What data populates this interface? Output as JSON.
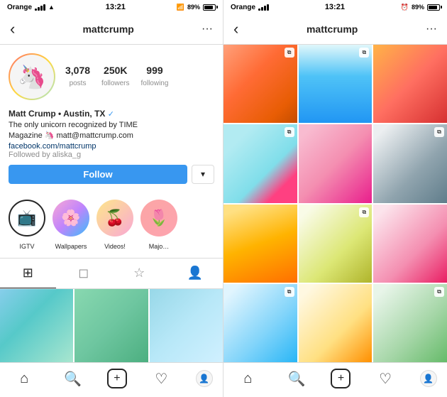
{
  "left": {
    "status": {
      "carrier": "Orange",
      "time": "13:21",
      "battery": "89%"
    },
    "nav": {
      "back_icon": "‹",
      "title": "mattcrump",
      "more_icon": "···"
    },
    "profile": {
      "avatar_emoji": "🦄",
      "stats": [
        {
          "number": "3,078",
          "label": "posts"
        },
        {
          "number": "250K",
          "label": "followers"
        },
        {
          "number": "999",
          "label": "following"
        }
      ],
      "name": "Matt Crump • Austin, TX",
      "verified": "✓",
      "bio_lines": [
        "The only unicorn recognized by TIME",
        "Magazine 🦄 matt@mattcrump.com",
        "facebook.com/mattcrump"
      ],
      "followed_by": "Followed by aliska_g",
      "follow_label": "Follow",
      "dropdown_label": "▾"
    },
    "stories": [
      {
        "label": "IGTV",
        "icon": "📺"
      },
      {
        "label": "Wallpapers",
        "icon": "🌸"
      },
      {
        "label": "Videos!",
        "icon": "🍒"
      },
      {
        "label": "Majo…",
        "icon": "🌷"
      }
    ],
    "tabs": [
      {
        "icon": "⊞",
        "active": true
      },
      {
        "icon": "◻",
        "active": false
      },
      {
        "icon": "☆",
        "active": false
      },
      {
        "icon": "👤",
        "active": false
      }
    ],
    "grid_colors": [
      "lc1",
      "c2",
      "c3",
      "c4",
      "c5",
      "c6"
    ],
    "bottom_nav": [
      {
        "icon": "⌂",
        "label": "home"
      },
      {
        "icon": "🔍",
        "label": "search"
      },
      {
        "icon": "⊕",
        "label": "add"
      },
      {
        "icon": "♡",
        "label": "activity"
      },
      {
        "icon": "👤",
        "label": "profile"
      }
    ]
  },
  "right": {
    "status": {
      "carrier": "Orange",
      "time": "13:21",
      "battery": "89%"
    },
    "nav": {
      "back_icon": "‹",
      "title": "mattcrump",
      "more_icon": "···"
    },
    "grid_colors": [
      "c1",
      "c2",
      "c3",
      "c4",
      "c5",
      "c6",
      "c7",
      "c8",
      "c9",
      "c10",
      "c11",
      "c12"
    ],
    "bottom_nav": [
      {
        "icon": "⌂",
        "label": "home"
      },
      {
        "icon": "🔍",
        "label": "search"
      },
      {
        "icon": "⊕",
        "label": "add"
      },
      {
        "icon": "♡",
        "label": "activity"
      },
      {
        "icon": "👤",
        "label": "profile"
      }
    ]
  }
}
